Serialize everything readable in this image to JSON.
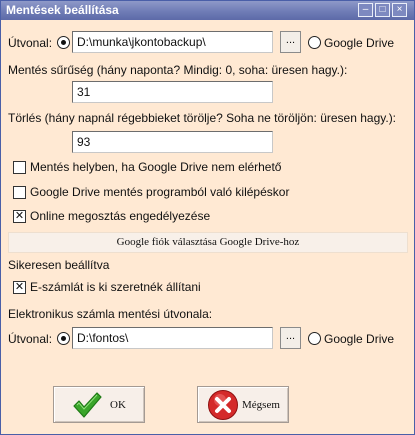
{
  "window": {
    "title": "Mentések beállítása",
    "minimize_glyph": "–",
    "maximize_glyph": "□",
    "close_glyph": "×"
  },
  "backup_path": {
    "label": "Útvonal:",
    "value": "D:\\munka\\jkontobackup\\",
    "browse_label": "...",
    "google_drive_label": "Google Drive",
    "selected": "local"
  },
  "frequency": {
    "label": "Mentés sűrűség (hány naponta? Mindig: 0, soha: üresen hagy.):",
    "value": "31"
  },
  "deletion": {
    "label": "Törlés (hány napnál régebbieket törölje? Soha ne töröljön: üresen hagy.):",
    "value": "93"
  },
  "options": [
    {
      "label": "Mentés helyben, ha Google Drive nem elérhető",
      "checked": false
    },
    {
      "label": "Google Drive mentés programból való kilépéskor",
      "checked": false
    },
    {
      "label": "Online megosztás engedélyezése",
      "checked": true
    }
  ],
  "google_account_button": "Google fiók választása Google Drive-hoz",
  "status_text": "Sikeresen beállítva",
  "einvoice_option": {
    "label": "E-számlát is ki szeretnék állítani",
    "checked": true
  },
  "einvoice_path": {
    "heading": "Elektronikus számla mentési útvonala:",
    "label": "Útvonal:",
    "value": "D:\\fontos\\",
    "browse_label": "...",
    "google_drive_label": "Google Drive",
    "selected": "local"
  },
  "buttons": {
    "ok": "OK",
    "cancel": "Mégsem"
  },
  "colors": {
    "dialog_background": "#ffe9d3",
    "titlebar": "#6f7cb6",
    "ok_icon": "#3aa52a",
    "cancel_icon": "#d42a2a"
  }
}
